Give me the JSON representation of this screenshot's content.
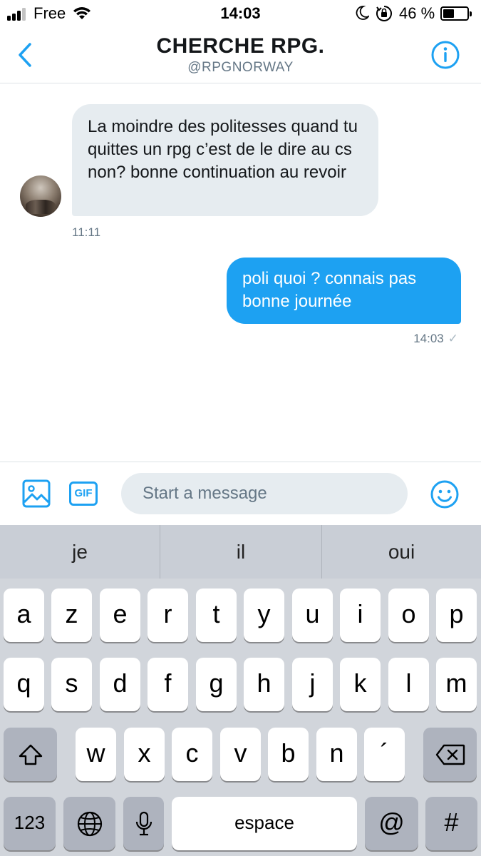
{
  "status_bar": {
    "carrier": "Free",
    "time": "14:03",
    "battery_percent": "46 %",
    "battery_level": 0.46,
    "signal_bars_filled": 3,
    "icons": [
      "signal-icon",
      "wifi-icon",
      "moon-icon",
      "rotation-lock-icon",
      "battery-icon"
    ]
  },
  "header": {
    "back_icon": "chevron-left-icon",
    "title": "CHERCHE RPG.",
    "handle": "@RPGNORWAY",
    "info_icon": "info-icon"
  },
  "messages": [
    {
      "direction": "incoming",
      "text": "La moindre des politesses quand tu quittes un rpg c’est de le dire au cs non? bonne continuation au revoir",
      "time": "11:11"
    },
    {
      "direction": "outgoing",
      "text": "poli quoi ? connais pas bonne journée",
      "time": "14:03",
      "status": "✓"
    }
  ],
  "composer": {
    "image_icon": "image-icon",
    "gif_label": "GIF",
    "placeholder": "Start a message",
    "value": "",
    "emoji_icon": "smiley-icon"
  },
  "keyboard": {
    "suggestions": [
      "je",
      "il",
      "oui"
    ],
    "row1": [
      "a",
      "z",
      "e",
      "r",
      "t",
      "y",
      "u",
      "i",
      "o",
      "p"
    ],
    "row2": [
      "q",
      "s",
      "d",
      "f",
      "g",
      "h",
      "j",
      "k",
      "l",
      "m"
    ],
    "row3": [
      "w",
      "x",
      "c",
      "v",
      "b",
      "n",
      "´"
    ],
    "numbers_label": "123",
    "space_label": "espace",
    "at_label": "@",
    "hash_label": "#",
    "colors": {
      "accent": "#1da1f2",
      "incoming_bubble": "#e6ecf0",
      "keyboard_bg": "#d1d5db"
    }
  }
}
